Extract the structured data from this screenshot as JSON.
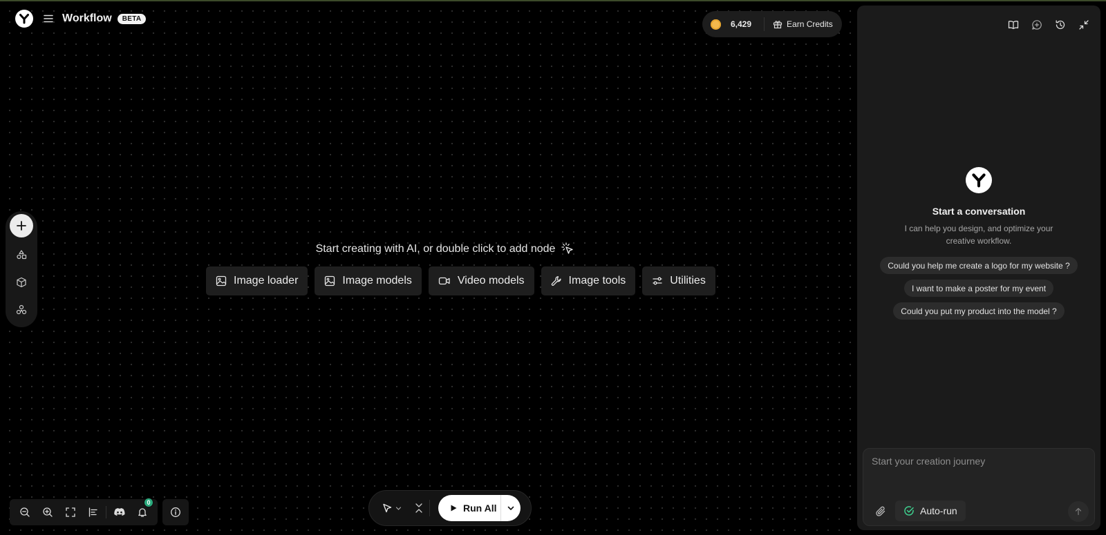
{
  "header": {
    "app_title": "Workflow",
    "badge": "BETA",
    "logo_icon": "y-logo-icon",
    "menu_icon": "hamburger-menu-icon"
  },
  "credits": {
    "balance": "6,429",
    "coin_icon": "coin-icon",
    "earn_label": "Earn Credits",
    "earn_icon": "gift-icon",
    "coin_color": "#f3b94d"
  },
  "left_rail": {
    "items": [
      {
        "icon": "plus-icon"
      },
      {
        "icon": "shapes-icon"
      },
      {
        "icon": "cube-icon"
      },
      {
        "icon": "cluster-icon"
      }
    ]
  },
  "canvas": {
    "hint": "Start creating with AI, or double click to add node",
    "hint_icon": "pointer-click-icon",
    "chips": [
      {
        "label": "Image loader",
        "icon": "image-icon"
      },
      {
        "label": "Image models",
        "icon": "image-icon"
      },
      {
        "label": "Video models",
        "icon": "video-icon"
      },
      {
        "label": "Image tools",
        "icon": "wrench-icon"
      },
      {
        "label": "Utilities",
        "icon": "sliders-icon"
      }
    ]
  },
  "zoombar": {
    "items": [
      "zoom-out-icon",
      "zoom-in-icon",
      "fit-view-icon",
      "align-icon",
      "discord-icon",
      "bell-icon"
    ],
    "notification_count": "0",
    "notification_color": "#2aa97c",
    "info_icon": "info-icon"
  },
  "runbar": {
    "select_icon": "pointer-icon",
    "collapse_icon": "collapse-icon",
    "run_label": "Run All",
    "run_icon": "play-icon",
    "dropdown_icon": "chevron-down-icon"
  },
  "chat": {
    "tools": [
      "book-icon",
      "new-chat-icon",
      "history-icon",
      "minimize-icon"
    ],
    "title": "Start a conversation",
    "subtitle": "I can help you design, and optimize your creative workflow.",
    "suggestions": [
      "Could you help me create a logo for my website ?",
      "I want to make a poster for my event",
      "Could you put my product into the model ?"
    ],
    "input_placeholder": "Start your creation journey",
    "attach_icon": "paperclip-icon",
    "autorun_label": "Auto-run",
    "autorun_icon": "check-circle-icon",
    "send_icon": "arrow-up-icon",
    "accent": "#3ecf8e"
  }
}
